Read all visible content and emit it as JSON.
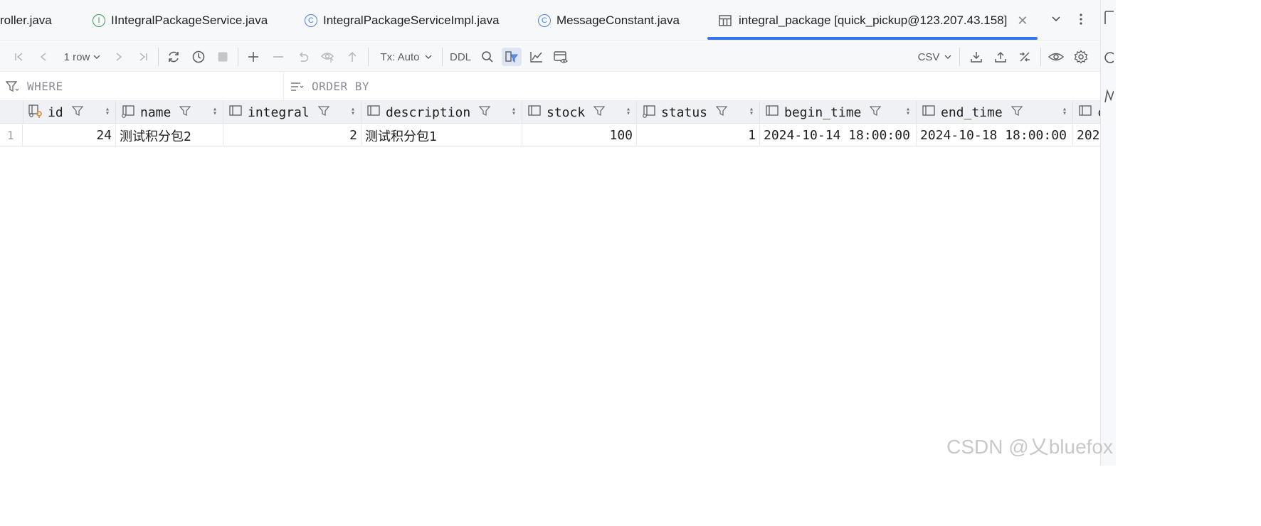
{
  "tabs": [
    {
      "label": "roller.java",
      "icon": "none"
    },
    {
      "label": "IIntegralPackageService.java",
      "icon": "interface-icon"
    },
    {
      "label": "IntegralPackageServiceImpl.java",
      "icon": "class-icon"
    },
    {
      "label": "MessageConstant.java",
      "icon": "class-icon"
    },
    {
      "label": "integral_package [quick_pickup@123.207.43.158]",
      "icon": "table-icon",
      "active": true
    }
  ],
  "toolbar": {
    "row_count": "1 row",
    "tx_mode": "Tx: Auto",
    "ddl_label": "DDL",
    "export_format": "CSV"
  },
  "filter": {
    "where_label": "WHERE",
    "order_by_label": "ORDER BY"
  },
  "table": {
    "columns": [
      "id",
      "name",
      "integral",
      "description",
      "stock",
      "status",
      "begin_time",
      "end_time",
      "c"
    ],
    "rows": [
      {
        "row_number": "1",
        "values": [
          "24",
          "测试积分包2",
          "2",
          "测试积分包1",
          "100",
          "1",
          "2024-10-14 18:00:00",
          "2024-10-18 18:00:00",
          "202"
        ]
      }
    ]
  },
  "colors": {
    "accent": "#3574f0",
    "key_icon": "#e08a2e"
  },
  "watermark": "CSDN @乂bluefox"
}
